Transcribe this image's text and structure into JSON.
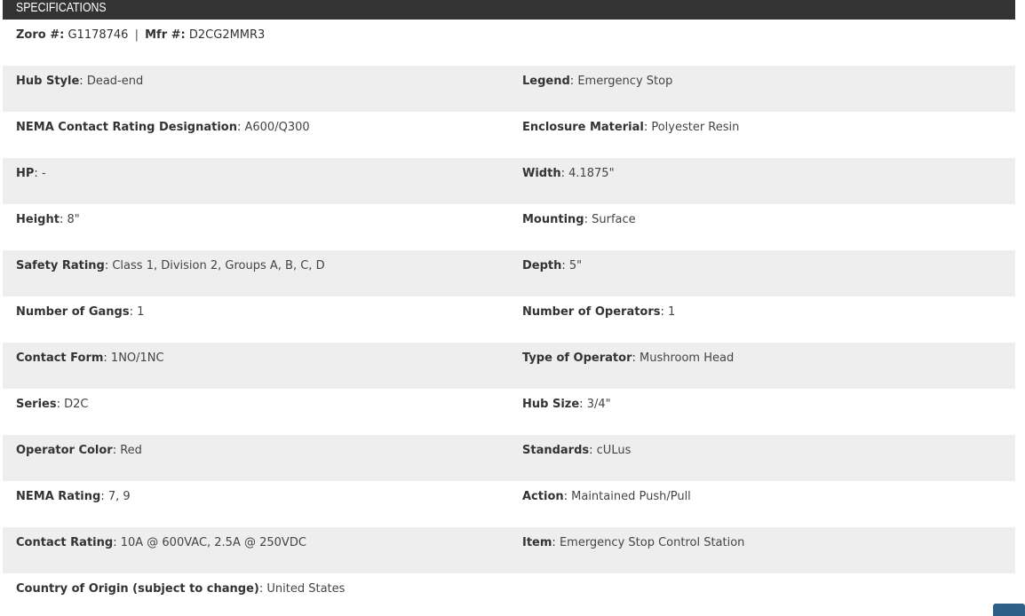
{
  "header": {
    "title": "SPECIFICATIONS"
  },
  "ids": {
    "zoro_label": "Zoro #:",
    "zoro_value": "G1178746",
    "separator": "|",
    "mfr_label": "Mfr #:",
    "mfr_value": "D2CG2MMR3"
  },
  "rows": [
    {
      "left_label": "Hub Style",
      "left_value": "Dead-end",
      "right_label": "Legend",
      "right_value": "Emergency Stop"
    },
    {
      "left_label": "NEMA Contact Rating Designation",
      "left_value": "A600/Q300",
      "right_label": "Enclosure Material",
      "right_value": "Polyester Resin"
    },
    {
      "left_label": "HP",
      "left_value": "-",
      "right_label": "Width",
      "right_value": "4.1875\""
    },
    {
      "left_label": "Height",
      "left_value": "8\"",
      "right_label": "Mounting",
      "right_value": "Surface"
    },
    {
      "left_label": "Safety Rating",
      "left_value": "Class 1, Division 2, Groups A, B, C, D",
      "right_label": "Depth",
      "right_value": "5\""
    },
    {
      "left_label": "Number of Gangs",
      "left_value": "1",
      "right_label": "Number of Operators",
      "right_value": "1"
    },
    {
      "left_label": "Contact Form",
      "left_value": "1NO/1NC",
      "right_label": "Type of Operator",
      "right_value": "Mushroom Head"
    },
    {
      "left_label": "Series",
      "left_value": "D2C",
      "right_label": "Hub Size",
      "right_value": "3/4\""
    },
    {
      "left_label": "Operator Color",
      "left_value": "Red",
      "right_label": "Standards",
      "right_value": "cULus"
    },
    {
      "left_label": "NEMA Rating",
      "left_value": "7, 9",
      "right_label": "Action",
      "right_value": "Maintained Push/Pull"
    },
    {
      "left_label": "Contact Rating",
      "left_value": "10A @ 600VAC, 2.5A @ 250VDC",
      "right_label": "Item",
      "right_value": "Emergency Stop Control Station"
    },
    {
      "left_label": "Country of Origin (subject to change)",
      "left_value": "United States",
      "right_label": "",
      "right_value": ""
    }
  ],
  "colors": {
    "header_bg": "#333333",
    "row_shade": "#eeeeee",
    "float_button": "#2f5f86"
  }
}
